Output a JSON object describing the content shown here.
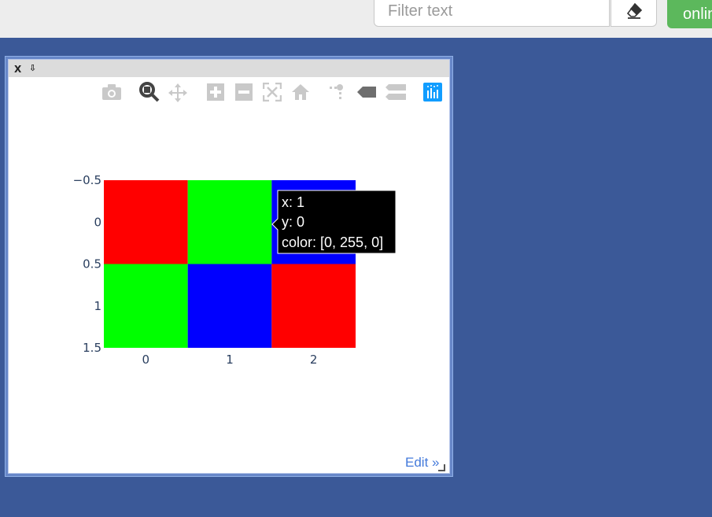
{
  "header": {
    "filter_placeholder": "Filter text",
    "clear_icon": "eraser-icon",
    "online_label": "online",
    "accent_green": "#5cb85c"
  },
  "panel": {
    "close_label": "X",
    "minimize_label": "⇩",
    "edit_label": "Edit »"
  },
  "modebar": [
    "camera-icon",
    "zoom-icon",
    "pan-icon",
    "zoom-in-icon",
    "zoom-out-icon",
    "autoscale-icon",
    "home-icon",
    "spike-lines-icon",
    "hover-closest-icon",
    "hover-compare-icon",
    "plotly-logo-icon"
  ],
  "chart_data": {
    "type": "heatmap",
    "x": [
      0,
      1,
      2
    ],
    "y": [
      0,
      1
    ],
    "colors": [
      [
        [
          255,
          0,
          0
        ],
        [
          0,
          255,
          0
        ],
        [
          0,
          0,
          255
        ]
      ],
      [
        [
          0,
          255,
          0
        ],
        [
          0,
          0,
          255
        ],
        [
          255,
          0,
          0
        ]
      ]
    ],
    "x_ticks": [
      "0",
      "1",
      "2"
    ],
    "y_ticks": [
      "−0.5",
      "0",
      "0.5",
      "1",
      "1.5"
    ],
    "ylim": [
      1.5,
      -0.5
    ],
    "xlim": [
      -0.5,
      2.5
    ]
  },
  "tooltip": {
    "x_line": "x: 1",
    "y_line": "y: 0",
    "color_line": "color: [0, 255, 0]"
  }
}
